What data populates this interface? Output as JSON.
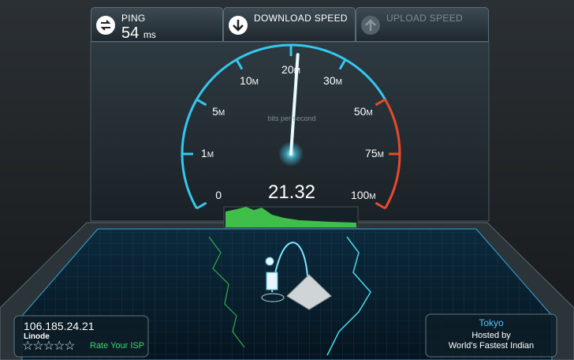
{
  "ping": {
    "label": "PING",
    "value": "54",
    "unit": "ms"
  },
  "download": {
    "label": "DOWNLOAD SPEED"
  },
  "upload": {
    "label": "UPLOAD SPEED"
  },
  "gauge": {
    "reading": "21.32",
    "units_label": "bits per second",
    "ticks": [
      {
        "text": "0",
        "unit": ""
      },
      {
        "text": "1",
        "unit": "M"
      },
      {
        "text": "5",
        "unit": "M"
      },
      {
        "text": "10",
        "unit": "M"
      },
      {
        "text": "20",
        "unit": "M"
      },
      {
        "text": "30",
        "unit": "M"
      },
      {
        "text": "50",
        "unit": "M"
      },
      {
        "text": "75",
        "unit": "M"
      },
      {
        "text": "100",
        "unit": "M"
      }
    ],
    "needle_value_mbps": 21.32
  },
  "client": {
    "ip": "106.185.24.21",
    "isp": "Linode",
    "stars_filled": 0,
    "stars_total": 5,
    "rate_label": "Rate Your ISP"
  },
  "server": {
    "city": "Tokyo",
    "hosted_by": "Hosted by",
    "host": "World's Fastest Indian"
  },
  "colors": {
    "accent": "#35c8ee",
    "danger": "#e84a2c",
    "good": "#3fd86a"
  }
}
